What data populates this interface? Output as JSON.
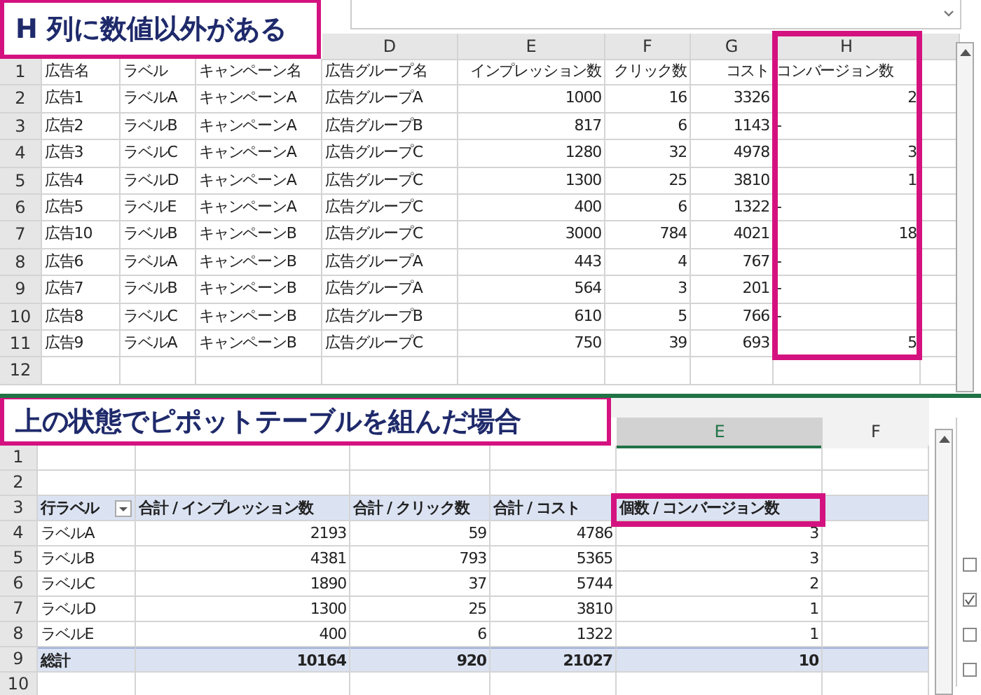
{
  "top_sheet": {
    "callout": "H 列に数値以外がある",
    "column_headers": [
      "D",
      "E",
      "F",
      "G",
      "H"
    ],
    "rows": [
      {
        "number": "1",
        "cells": [
          "広告名",
          "ラベル",
          "キャンペーン名",
          "広告グループ名",
          "インプレッション数",
          "クリック数",
          "コスト"
        ],
        "conversion": {
          "text": "コンバージョン数",
          "kind": "text"
        }
      },
      {
        "number": "2",
        "cells": [
          "広告1",
          "ラベルA",
          "キャンペーンA",
          "広告グループA",
          "1000",
          "16",
          "3326"
        ],
        "conversion": {
          "text": "2",
          "kind": "number"
        }
      },
      {
        "number": "3",
        "cells": [
          "広告2",
          "ラベルB",
          "キャンペーンA",
          "広告グループB",
          "817",
          "6",
          "1143"
        ],
        "conversion": {
          "text": "-",
          "kind": "text"
        }
      },
      {
        "number": "4",
        "cells": [
          "広告3",
          "ラベルC",
          "キャンペーンA",
          "広告グループC",
          "1280",
          "32",
          "4978"
        ],
        "conversion": {
          "text": "3",
          "kind": "number"
        }
      },
      {
        "number": "5",
        "cells": [
          "広告4",
          "ラベルD",
          "キャンペーンA",
          "広告グループC",
          "1300",
          "25",
          "3810"
        ],
        "conversion": {
          "text": "1",
          "kind": "number"
        }
      },
      {
        "number": "6",
        "cells": [
          "広告5",
          "ラベルE",
          "キャンペーンA",
          "広告グループC",
          "400",
          "6",
          "1322"
        ],
        "conversion": {
          "text": "-",
          "kind": "text"
        }
      },
      {
        "number": "7",
        "cells": [
          "広告10",
          "ラベルB",
          "キャンペーンB",
          "広告グループC",
          "3000",
          "784",
          "4021"
        ],
        "conversion": {
          "text": "18",
          "kind": "number"
        }
      },
      {
        "number": "8",
        "cells": [
          "広告6",
          "ラベルA",
          "キャンペーンB",
          "広告グループA",
          "443",
          "4",
          "767"
        ],
        "conversion": {
          "text": "-",
          "kind": "text"
        }
      },
      {
        "number": "9",
        "cells": [
          "広告7",
          "ラベルB",
          "キャンペーンB",
          "広告グループA",
          "564",
          "3",
          "201"
        ],
        "conversion": {
          "text": "-",
          "kind": "text"
        }
      },
      {
        "number": "10",
        "cells": [
          "広告8",
          "ラベルC",
          "キャンペーンB",
          "広告グループB",
          "610",
          "5",
          "766"
        ],
        "conversion": {
          "text": "-",
          "kind": "text"
        }
      },
      {
        "number": "11",
        "cells": [
          "広告9",
          "ラベルA",
          "キャンペーンB",
          "広告グループC",
          "750",
          "39",
          "693"
        ],
        "conversion": {
          "text": "5",
          "kind": "number"
        }
      },
      {
        "number": "12",
        "cells": [],
        "conversion": null
      }
    ]
  },
  "pivot_sheet": {
    "callout": "上の状態でピポットテーブルを組んだ場合",
    "column_headers": [
      {
        "label": "E",
        "selected": true
      },
      {
        "label": "F",
        "selected": false
      }
    ],
    "rows": [
      {
        "number": "1",
        "kind": "blank",
        "cells": []
      },
      {
        "number": "2",
        "kind": "blank",
        "cells": []
      },
      {
        "number": "3",
        "kind": "header",
        "cells": [
          "行ラベル",
          "合計 / インプレッション数",
          "合計 / クリック数",
          "合計 / コスト",
          "個数 / コンバージョン数"
        ]
      },
      {
        "number": "4",
        "kind": "data",
        "cells": [
          "ラベルA",
          "2193",
          "59",
          "4786",
          "3"
        ]
      },
      {
        "number": "5",
        "kind": "data",
        "cells": [
          "ラベルB",
          "4381",
          "793",
          "5365",
          "3"
        ]
      },
      {
        "number": "6",
        "kind": "data",
        "cells": [
          "ラベルC",
          "1890",
          "37",
          "5744",
          "2"
        ]
      },
      {
        "number": "7",
        "kind": "data",
        "cells": [
          "ラベルD",
          "1300",
          "25",
          "3810",
          "1"
        ]
      },
      {
        "number": "8",
        "kind": "data",
        "cells": [
          "ラベルE",
          "400",
          "6",
          "1322",
          "1"
        ]
      },
      {
        "number": "9",
        "kind": "total",
        "cells": [
          "総計",
          "10164",
          "920",
          "21027",
          "10"
        ]
      },
      {
        "number": "10",
        "kind": "blank",
        "cells": []
      }
    ]
  }
}
